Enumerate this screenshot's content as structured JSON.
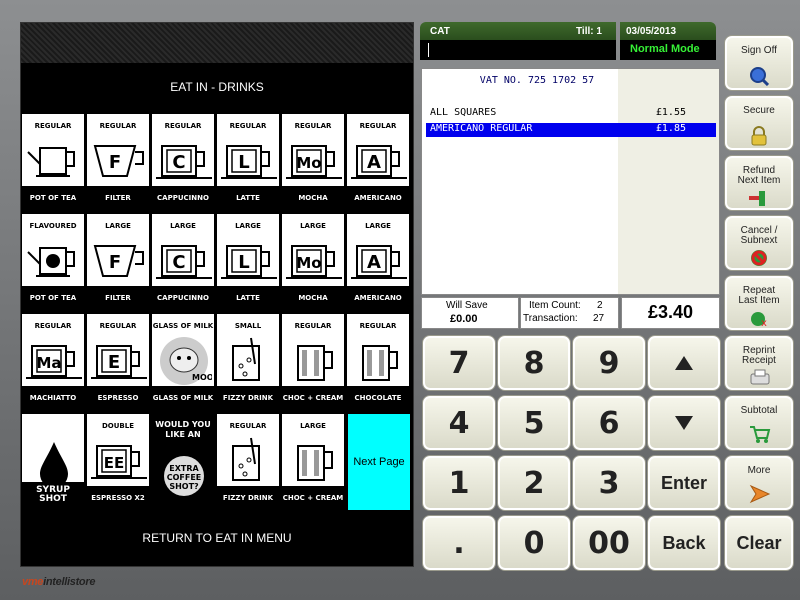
{
  "category_title": "EAT IN - DRINKS",
  "return_label": "RETURN TO EAT IN MENU",
  "next_page_label": "Next Page",
  "brand": {
    "prefix": "vme",
    "suffix": "intellistore"
  },
  "products": [
    {
      "top": "REGULAR",
      "bottom": "POT OF TEA",
      "icon": "teapot-icon",
      "letter": ""
    },
    {
      "top": "REGULAR",
      "bottom": "FILTER",
      "icon": "filter-icon",
      "letter": "F"
    },
    {
      "top": "REGULAR",
      "bottom": "CAPPUCINNO",
      "icon": "cup-icon",
      "letter": "C"
    },
    {
      "top": "REGULAR",
      "bottom": "LATTE",
      "icon": "cup-icon",
      "letter": "L"
    },
    {
      "top": "REGULAR",
      "bottom": "MOCHA",
      "icon": "cup-icon",
      "letter": "Mo"
    },
    {
      "top": "REGULAR",
      "bottom": "AMERICANO",
      "icon": "cup-icon",
      "letter": "A"
    },
    {
      "top": "FLAVOURED",
      "bottom": "POT OF TEA",
      "icon": "flavoured-teapot-icon",
      "letter": ""
    },
    {
      "top": "LARGE",
      "bottom": "FILTER",
      "icon": "filter-icon",
      "letter": "F"
    },
    {
      "top": "LARGE",
      "bottom": "CAPPUCINNO",
      "icon": "cup-icon",
      "letter": "C"
    },
    {
      "top": "LARGE",
      "bottom": "LATTE",
      "icon": "cup-icon",
      "letter": "L"
    },
    {
      "top": "LARGE",
      "bottom": "MOCHA",
      "icon": "cup-icon",
      "letter": "Mo"
    },
    {
      "top": "LARGE",
      "bottom": "AMERICANO",
      "icon": "cup-icon",
      "letter": "A"
    },
    {
      "top": "REGULAR",
      "bottom": "MACHIATTO",
      "icon": "cup-icon",
      "letter": "Ma"
    },
    {
      "top": "REGULAR",
      "bottom": "ESPRESSO",
      "icon": "cup-icon",
      "letter": "E"
    },
    {
      "top": "GLASS OF MILK",
      "bottom": "GLASS OF MILK",
      "icon": "cow-icon",
      "letter": "MOO!"
    },
    {
      "top": "SMALL",
      "bottom": "FIZZY DRINK",
      "icon": "fizzy-glass-icon",
      "letter": ""
    },
    {
      "top": "REGULAR",
      "bottom": "CHOC + CREAM",
      "icon": "mug-icon",
      "letter": ""
    },
    {
      "top": "REGULAR",
      "bottom": "CHOCOLATE",
      "icon": "mug-icon",
      "letter": ""
    },
    {
      "top": "",
      "bottom": "SYRUP SHOT",
      "icon": "syrup-drop-icon",
      "letter": ""
    },
    {
      "top": "DOUBLE",
      "bottom": "ESPRESSO X2",
      "icon": "cup-icon",
      "letter": "EE"
    },
    {
      "top": "WOULD YOU LIKE AN",
      "bottom": "EXTRA COFFEE SHOT?",
      "icon": "extra-shot-icon",
      "letter": ""
    },
    {
      "top": "REGULAR",
      "bottom": "FIZZY DRINK",
      "icon": "fizzy-glass-icon",
      "letter": ""
    },
    {
      "top": "LARGE",
      "bottom": "CHOC + CREAM",
      "icon": "mug-icon",
      "letter": ""
    }
  ],
  "header": {
    "operator": "CAT",
    "till": "Till: 1",
    "date": "03/05/2013",
    "mode": "Normal Mode"
  },
  "receipt": {
    "vat": "VAT NO. 725 1702 57",
    "lines": [
      {
        "name": "ALL SQUARES",
        "price": "£1.55",
        "selected": false
      },
      {
        "name": "AMERICANO REGULAR",
        "price": "£1.85",
        "selected": true
      }
    ]
  },
  "totals": {
    "will_save_label": "Will Save",
    "will_save_value": "£0.00",
    "item_count_label": "Item Count:",
    "item_count_value": "2",
    "transaction_label": "Transaction:",
    "transaction_value": "27",
    "total": "£3.40"
  },
  "keypad": [
    "7",
    "8",
    "9",
    "4",
    "5",
    "6",
    "1",
    "2",
    "3",
    ".",
    "0",
    "00"
  ],
  "keypad_actions": {
    "enter": "Enter",
    "back": "Back",
    "clear": "Clear"
  },
  "side_buttons": [
    {
      "label1": "Sign Off",
      "label2": ""
    },
    {
      "label1": "Secure",
      "label2": ""
    },
    {
      "label1": "Refund",
      "label2": "Next  Item"
    },
    {
      "label1": "Cancel /",
      "label2": "Subnext"
    },
    {
      "label1": "Repeat",
      "label2": "Last Item"
    },
    {
      "label1": "Reprint",
      "label2": "Receipt"
    },
    {
      "label1": "Subtotal",
      "label2": ""
    },
    {
      "label1": "More",
      "label2": ""
    }
  ]
}
